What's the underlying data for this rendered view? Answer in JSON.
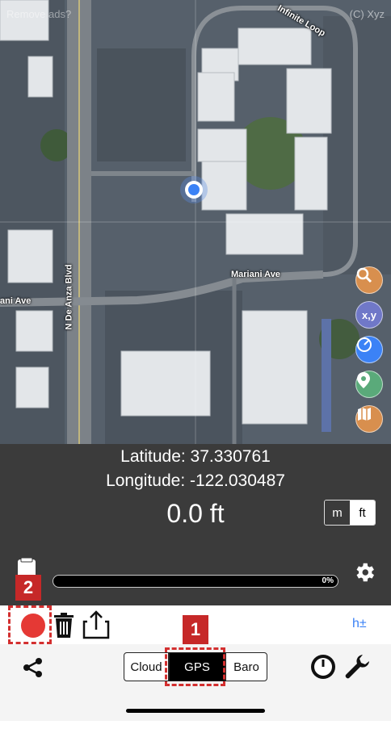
{
  "map": {
    "ad_text": "Remove ads?",
    "copyright": "(C) Xyz",
    "streets": {
      "infinite_loop": "Infinite Loop",
      "mariani_ave": "Mariani Ave",
      "mariani_ave_left": "ani Ave",
      "de_anza": "N De Anza Blvd"
    },
    "fab_xy_label": "x,y"
  },
  "info": {
    "latitude": "Latitude: 37.330761",
    "longitude": "Longitude: -122.030487",
    "altitude": "0.0 ft",
    "unit_m": "m",
    "unit_ft": "ft",
    "progress_label": "0%",
    "progress_value": 0
  },
  "toolbar": {
    "precision_label": "h±"
  },
  "bottom": {
    "seg_cloud": "Cloud",
    "seg_gps": "GPS",
    "seg_baro": "Baro"
  },
  "annotations": {
    "badge_1": "1",
    "badge_2": "2"
  },
  "colors": {
    "record": "#e53935",
    "highlight": "#c62828",
    "accent_blue": "#3b82f6"
  }
}
